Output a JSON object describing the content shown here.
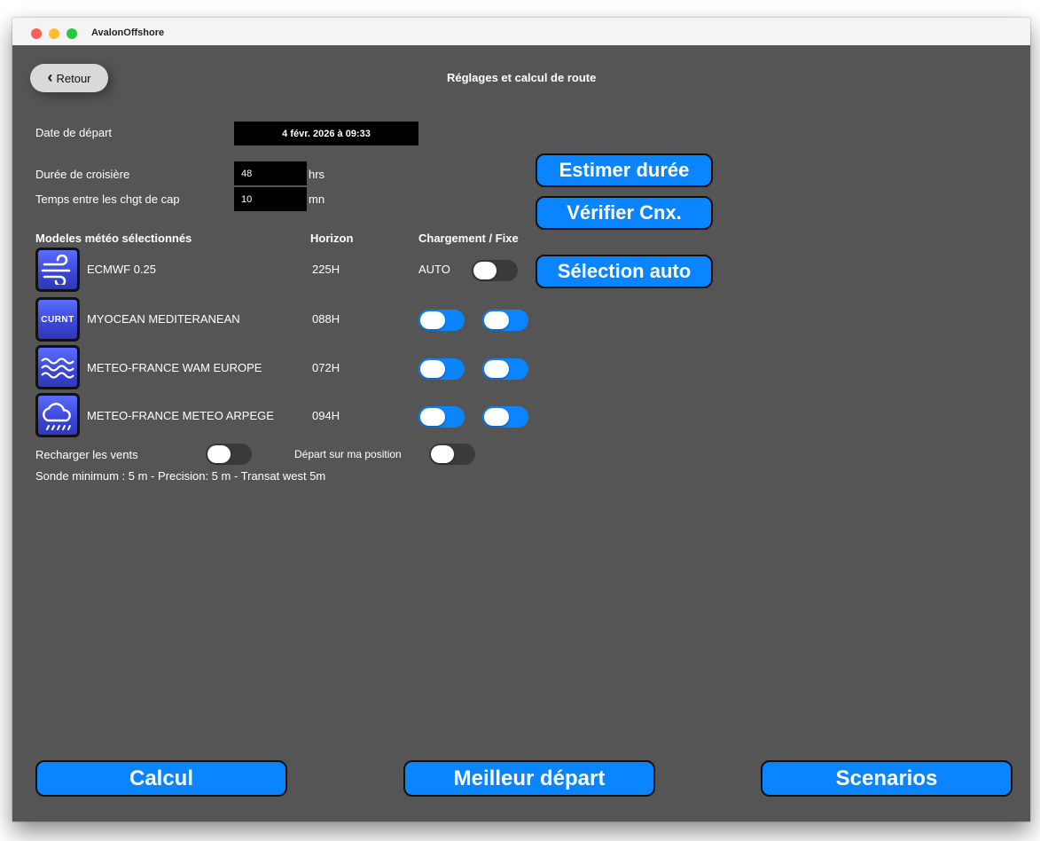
{
  "window": {
    "title": "AvalonOffshore"
  },
  "header": {
    "back_label": "Retour",
    "title": "Réglages et calcul de route"
  },
  "departure": {
    "label": "Date de départ",
    "value": "4 févr. 2026 à 09:33"
  },
  "duration": {
    "label": "Durée de croisière",
    "value": "48",
    "unit": "hrs"
  },
  "heading_interval": {
    "label": "Temps entre les chgt de cap",
    "value": "10",
    "unit": "mn"
  },
  "actions": {
    "estimate": "Estimer durée",
    "verify": "Vérifier Cnx.",
    "auto_select": "Sélection auto"
  },
  "models_table": {
    "headers": {
      "model": "Modeles météo sélectionnés",
      "horizon": "Horizon",
      "load": "Chargement / Fixe"
    },
    "rows": [
      {
        "name": "ECMWF 0.25",
        "horizon": "225H",
        "icon": "wind-icon",
        "load_text": "AUTO",
        "load_on": null,
        "fixed_on": false
      },
      {
        "name": "MYOCEAN MEDITERANEAN",
        "horizon": "088H",
        "icon": "current-icon",
        "icon_text": "CURNT",
        "load_on": true,
        "fixed_on": true
      },
      {
        "name": "METEO-FRANCE WAM EUROPE",
        "horizon": "072H",
        "icon": "waves-icon",
        "load_on": true,
        "fixed_on": true
      },
      {
        "name": "METEO-FRANCE METEO ARPEGE",
        "horizon": "094H",
        "icon": "cloud-rain-icon",
        "load_on": true,
        "fixed_on": true
      }
    ]
  },
  "options": {
    "reload_winds_label": "Recharger les vents",
    "reload_winds_on": false,
    "start_position_label": "Départ sur ma position",
    "start_position_on": false
  },
  "info_line": "Sonde minimum : 5 m - Precision: 5 m - Transat west 5m",
  "bottom": {
    "compute": "Calcul",
    "best_start": "Meilleur départ",
    "scenarios": "Scenarios"
  },
  "colors": {
    "accent": "#0a84ff",
    "background": "#555555"
  }
}
